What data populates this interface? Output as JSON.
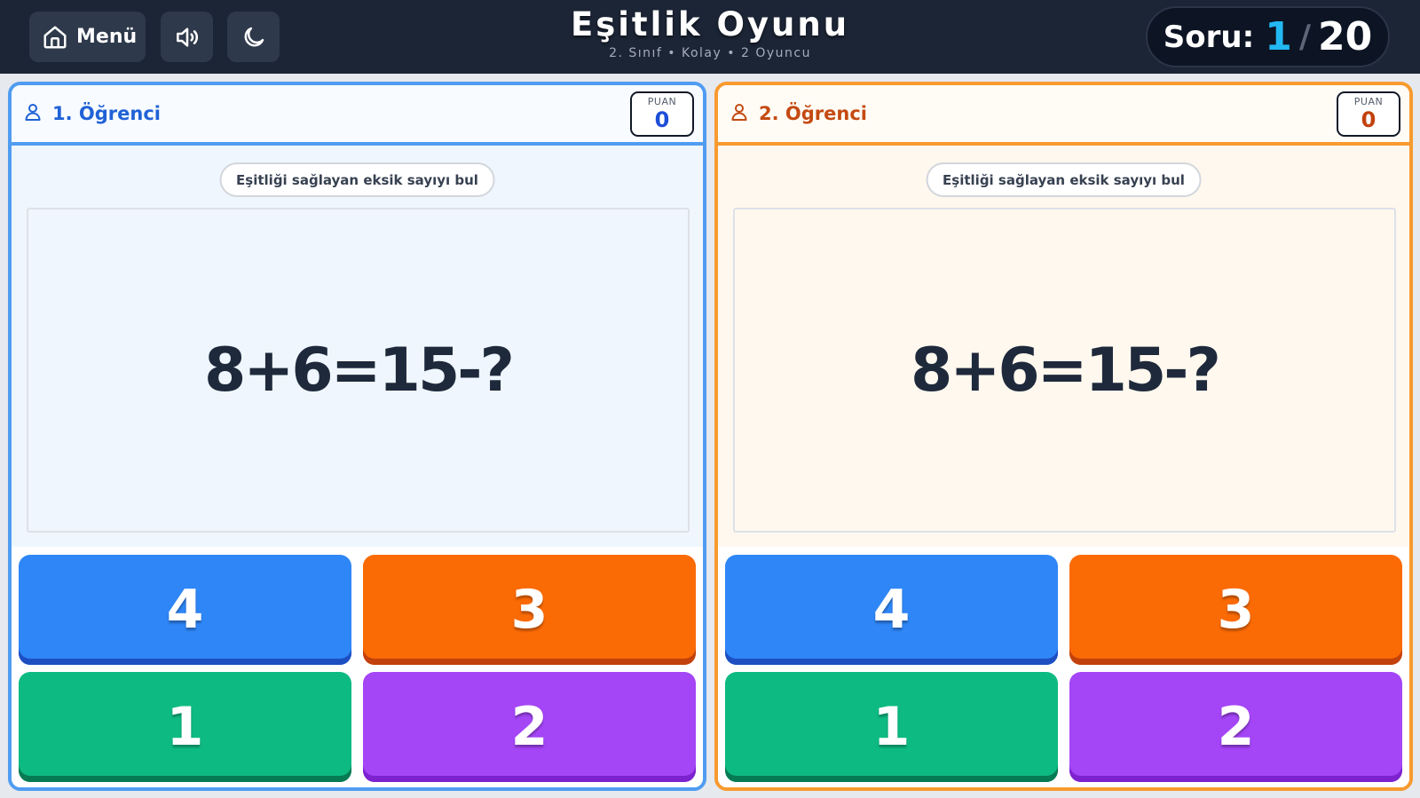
{
  "header": {
    "menu_label": "Menü",
    "title": "Eşitlik Oyunu",
    "subtitle": "2. Sınıf • Kolay • 2 Oyuncu",
    "counter_label": "Soru:",
    "counter_current": "1",
    "counter_separator": "/",
    "counter_total": "20",
    "icons": [
      "home-icon",
      "speaker-icon",
      "moon-icon"
    ]
  },
  "players": [
    {
      "name": "1. Öğrenci",
      "score_label": "PUAN",
      "score": "0",
      "hint": "Eşitliği sağlayan eksik sayıyı bul",
      "question": "8+6=15-?",
      "answers": [
        "4",
        "3",
        "1",
        "2"
      ],
      "accent": "#4f9cf1"
    },
    {
      "name": "2. Öğrenci",
      "score_label": "PUAN",
      "score": "0",
      "hint": "Eşitliği sağlayan eksik sayıyı bul",
      "question": "8+6=15-?",
      "answers": [
        "4",
        "3",
        "1",
        "2"
      ],
      "accent": "#f89a2f"
    }
  ],
  "answer_colors": [
    "#2f86f6",
    "#fa6a05",
    "#0dba82",
    "#a445f6"
  ]
}
